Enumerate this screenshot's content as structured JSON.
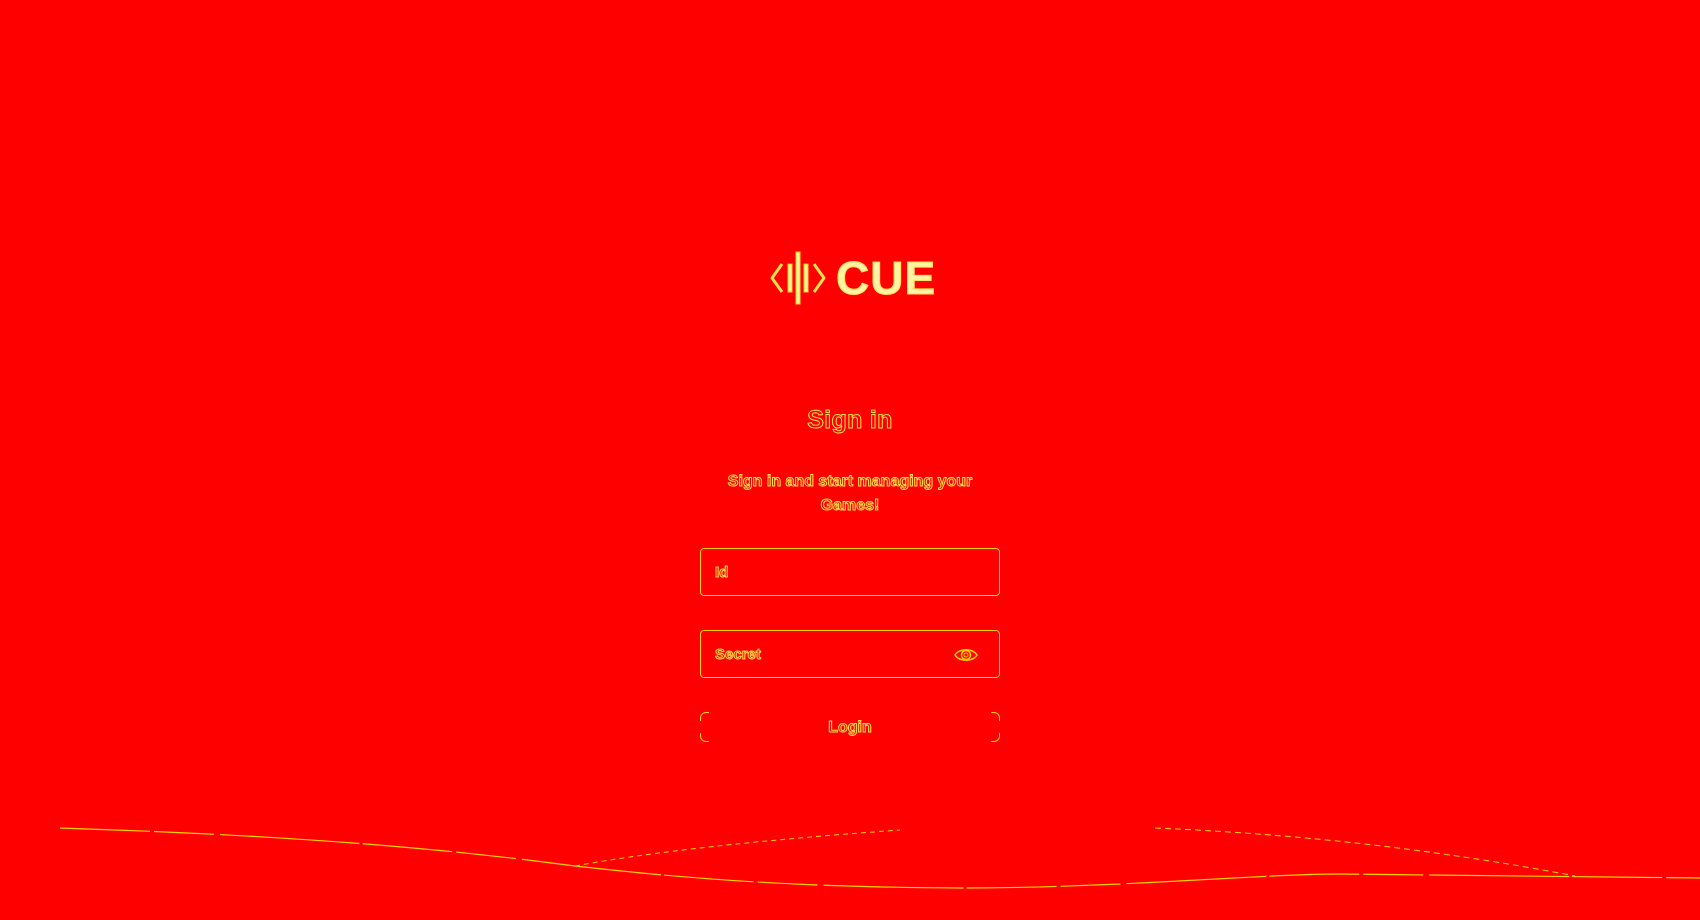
{
  "brand": {
    "name": "CUE",
    "logo_icon": "cue-code-bars-icon"
  },
  "signin": {
    "title": "Sign in",
    "subtitle": "Sign in and start managing your Games!",
    "id_placeholder": "Id",
    "id_value": "",
    "secret_placeholder": "Secret",
    "secret_value": "",
    "show_secret_icon": "eye-icon",
    "login_label": "Login"
  },
  "colors": {
    "background": "#ff0000",
    "accent": "#ffd400"
  }
}
